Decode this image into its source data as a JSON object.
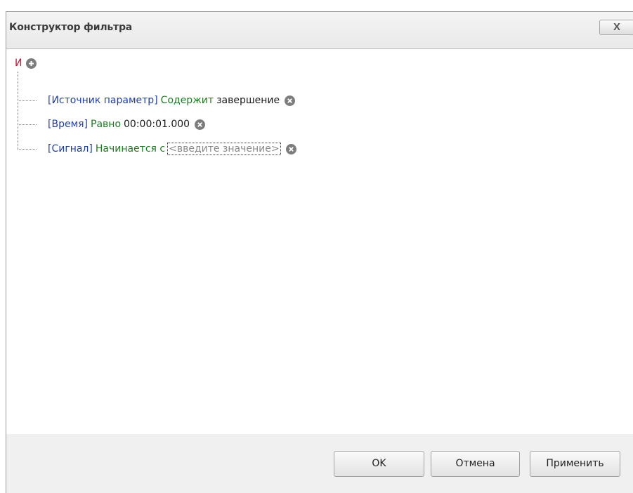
{
  "window": {
    "title": "Конструктор фильтра",
    "close_label": "X"
  },
  "filter": {
    "group_operator": "И",
    "conditions": [
      {
        "field": "[Источник параметр]",
        "operator": "Содержит",
        "value": "завершение"
      },
      {
        "field": "[Время]",
        "operator": "Равно",
        "value": "00:00:01.000"
      },
      {
        "field": "[Сигнал]",
        "operator": "Начинается с",
        "placeholder": "<введите значение>"
      }
    ]
  },
  "buttons": {
    "ok": "OK",
    "cancel": "Отмена",
    "apply": "Применить"
  },
  "icons": {
    "add": "plus-circle-icon",
    "remove": "x-circle-icon"
  },
  "colors": {
    "group_operator": "#c8102e",
    "field": "#1f3fa8",
    "operator": "#1e7b22",
    "value": "#1a1a1a",
    "placeholder": "#8a8a8a"
  }
}
